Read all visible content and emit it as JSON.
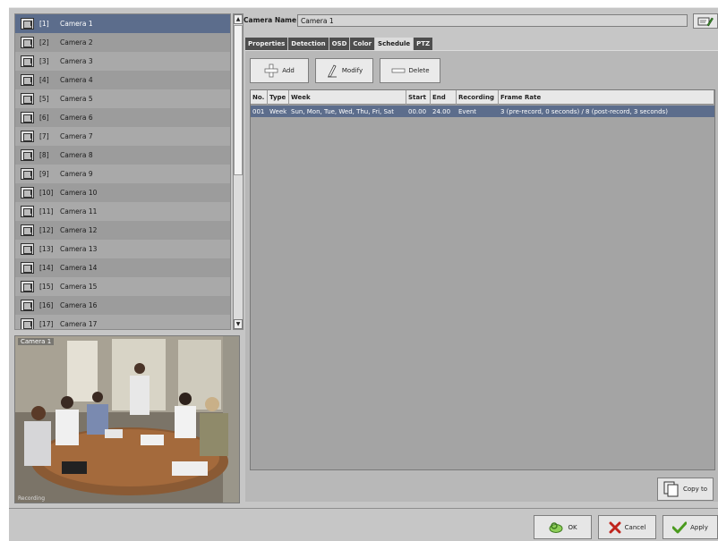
{
  "camera_list": {
    "items": [
      {
        "num": "[1]",
        "name": "Camera 1"
      },
      {
        "num": "[2]",
        "name": "Camera 2"
      },
      {
        "num": "[3]",
        "name": "Camera 3"
      },
      {
        "num": "[4]",
        "name": "Camera 4"
      },
      {
        "num": "[5]",
        "name": "Camera 5"
      },
      {
        "num": "[6]",
        "name": "Camera 6"
      },
      {
        "num": "[7]",
        "name": "Camera 7"
      },
      {
        "num": "[8]",
        "name": "Camera 8"
      },
      {
        "num": "[9]",
        "name": "Camera 9"
      },
      {
        "num": "[10]",
        "name": "Camera 10"
      },
      {
        "num": "[11]",
        "name": "Camera 11"
      },
      {
        "num": "[12]",
        "name": "Camera 12"
      },
      {
        "num": "[13]",
        "name": "Camera 13"
      },
      {
        "num": "[14]",
        "name": "Camera 14"
      },
      {
        "num": "[15]",
        "name": "Camera 15"
      },
      {
        "num": "[16]",
        "name": "Camera 16"
      },
      {
        "num": "[17]",
        "name": "Camera 17"
      }
    ],
    "selected": "[1]"
  },
  "preview": {
    "label": "Camera 1",
    "status": "Recording"
  },
  "camera_name": {
    "label": "Camera Name",
    "value": "Camera 1",
    "edit_icon": "edit-pencil-icon"
  },
  "tabs": [
    {
      "label": "Properties",
      "active": false
    },
    {
      "label": "Detection",
      "active": false
    },
    {
      "label": "OSD",
      "active": false
    },
    {
      "label": "Color",
      "active": false
    },
    {
      "label": "Schedule",
      "active": true
    },
    {
      "label": "PTZ",
      "active": false
    }
  ],
  "toolbar": {
    "add_label": "Add",
    "modify_label": "Modify",
    "delete_label": "Delete"
  },
  "schedule_table": {
    "columns": [
      "No.",
      "Type",
      "Week",
      "Start",
      "End",
      "Recording",
      "Frame Rate"
    ],
    "rows": [
      {
        "no": "001",
        "type": "Week",
        "week": "Sun, Mon, Tue, Wed, Thu, Fri, Sat",
        "start": "00.00",
        "end": "24.00",
        "recording": "Event",
        "frame_rate": "3 (pre-record, 0 seconds) / 8 (post-record, 3 seconds)"
      }
    ]
  },
  "copy_to_label": "Copy to",
  "footer": {
    "ok_label": "OK",
    "cancel_label": "Cancel",
    "apply_label": "Apply"
  },
  "colors": {
    "selection": "#5c6d8c",
    "window_bg": "#c6c6c6",
    "tab_bg": "#4e4e4e",
    "ok_icon": "#3d7a1e",
    "cancel_icon": "#c0241c",
    "apply_icon": "#4a9a1e"
  }
}
